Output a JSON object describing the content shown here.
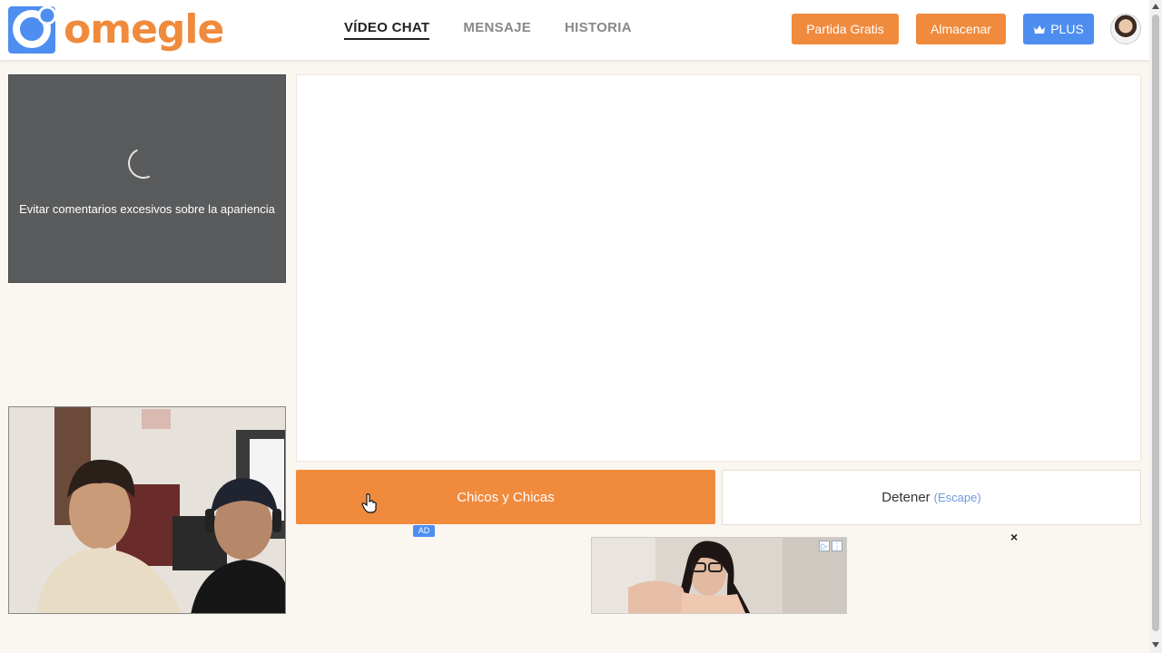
{
  "brand": {
    "name": "omegle"
  },
  "nav": {
    "items": [
      {
        "label": "VÍDEO CHAT",
        "active": true
      },
      {
        "label": "MENSAJE",
        "active": false
      },
      {
        "label": "HISTORIA",
        "active": false
      }
    ]
  },
  "header": {
    "free_match_label": "Partida Gratis",
    "store_label": "Almacenar",
    "plus_label": "PLUS"
  },
  "stranger_video": {
    "notice": "Evitar comentarios excesivos sobre la apariencia"
  },
  "controls": {
    "start_label": "Chicos y Chicas",
    "stop_label": "Detener",
    "stop_hint": "(Escape)"
  },
  "ad": {
    "badge": "AD",
    "close_label": "×"
  },
  "colors": {
    "accent_orange": "#f08a3c",
    "accent_blue": "#4d8ef0",
    "background": "#faf6f0"
  }
}
